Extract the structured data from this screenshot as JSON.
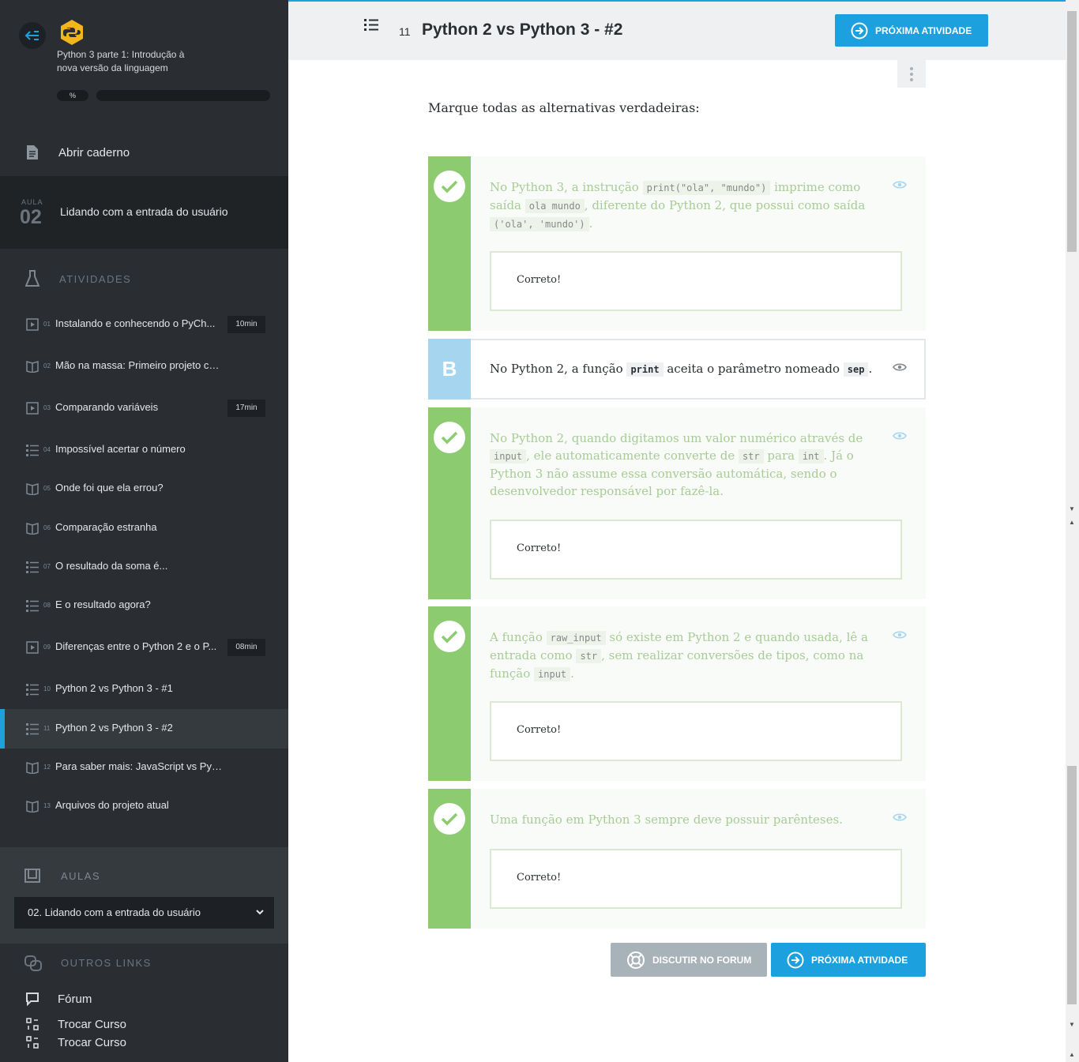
{
  "sidebar": {
    "course_title": "Python 3 parte 1: Introdução à nova versão da linguagem",
    "progress_label": "%",
    "notebook_label": "Abrir caderno",
    "lesson": {
      "small": "AULA",
      "number": "02",
      "title": "Lidando com a entrada do usuário"
    },
    "activities_heading": "ATIVIDADES",
    "activities": [
      {
        "num": "01",
        "title": "Instalando e conhecendo o PyCh...",
        "duration": "10min",
        "icon": "video-icon"
      },
      {
        "num": "02",
        "title": "Mão na massa: Primeiro projeto com ...",
        "duration": "",
        "icon": "book-icon"
      },
      {
        "num": "03",
        "title": "Comparando variáveis",
        "duration": "17min",
        "icon": "video-icon"
      },
      {
        "num": "04",
        "title": "Impossível acertar o número",
        "duration": "",
        "icon": "list-icon"
      },
      {
        "num": "05",
        "title": "Onde foi que ela errou?",
        "duration": "",
        "icon": "book-icon"
      },
      {
        "num": "06",
        "title": "Comparação estranha",
        "duration": "",
        "icon": "book-icon"
      },
      {
        "num": "07",
        "title": "O resultado da soma é...",
        "duration": "",
        "icon": "list-icon"
      },
      {
        "num": "08",
        "title": "E o resultado agora?",
        "duration": "",
        "icon": "list-icon"
      },
      {
        "num": "09",
        "title": "Diferenças entre o Python 2 e o P...",
        "duration": "08min",
        "icon": "video-icon"
      },
      {
        "num": "10",
        "title": "Python 2 vs Python 3 - #1",
        "duration": "",
        "icon": "list-icon"
      },
      {
        "num": "11",
        "title": "Python 2 vs Python 3 - #2",
        "duration": "",
        "icon": "list-icon"
      },
      {
        "num": "12",
        "title": "Para saber mais: JavaScript vs Python",
        "duration": "",
        "icon": "book-icon"
      },
      {
        "num": "13",
        "title": "Arquivos do projeto atual",
        "duration": "",
        "icon": "book-icon"
      }
    ],
    "aulas_heading": "AULAS",
    "aulas_selected": "02. Lidando com a entrada do usuário",
    "links_heading": "OUTROS LINKS",
    "links": [
      {
        "label": "Fórum",
        "icon": "forum-icon"
      },
      {
        "label": "Trocar Curso",
        "icon": "switch-course-icon"
      },
      {
        "label": "Trocar Curso",
        "icon": "switch-course-icon"
      }
    ]
  },
  "header": {
    "activity_number": "11",
    "title": "Python 2 vs Python 3 - #2",
    "next_label": "PRÓXIMA ATIVIDADE"
  },
  "question": "Marque todas as alternativas verdadeiras:",
  "alternatives": {
    "a": {
      "t1": "No Python 3, a instrução ",
      "c1": "print(\"ola\", \"mundo\")",
      "t2": " imprime como saída ",
      "c2": "ola mundo",
      "t3": ", diferente do Python 2, que possui como saída ",
      "c3": "('ola', 'mundo')",
      "t4": ".",
      "feedback": "Correto!"
    },
    "b": {
      "letter": "B",
      "t1": "No Python 2, a função ",
      "c1": "print",
      "t2": " aceita o parâmetro nomeado ",
      "c2": "sep",
      "t3": "."
    },
    "c": {
      "t1": "No Python 2, quando digitamos um valor numérico através de ",
      "c1": "input",
      "t2": ", ele automaticamente converte de ",
      "c2": "str",
      "t3": " para ",
      "c3": "int",
      "t4": ". Já o Python 3 não assume essa conversão automática, sendo o desenvolvedor responsável por fazê-la.",
      "feedback": "Correto!"
    },
    "d": {
      "t1": "A função ",
      "c1": "raw_input",
      "t2": " só existe em Python 2 e quando usada, lê a entrada como ",
      "c2": "str",
      "t3": ", sem realizar conversões de tipos, como na função ",
      "c3": "input",
      "t4": ".",
      "feedback": "Correto!"
    },
    "e": {
      "t1": "Uma função em Python 3 sempre deve possuir parênteses.",
      "feedback": "Correto!"
    }
  },
  "footer": {
    "forum_label": "DISCUTIR NO FORUM",
    "next_label": "PRÓXIMA ATIVIDADE"
  },
  "colors": {
    "accent": "#1da1de",
    "correct": "#8ccb70",
    "sidebar_bg": "#2a2e32"
  }
}
